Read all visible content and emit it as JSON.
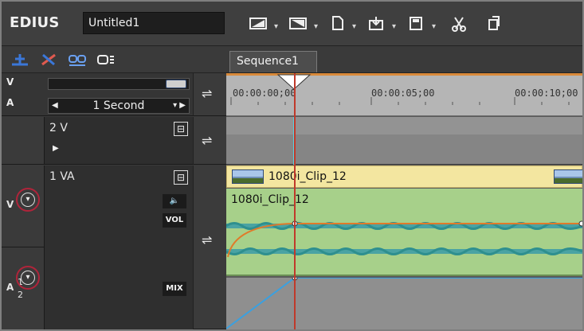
{
  "app": {
    "brand": "EDIUS",
    "project_name": "Untitled1"
  },
  "toolbar": {
    "icons": [
      "layout-icon",
      "layout-alt-icon",
      "new-file-icon",
      "import-icon",
      "save-icon",
      "cut-icon",
      "copy-icon"
    ]
  },
  "subtoolbar": {
    "sequence_tab": "Sequence1"
  },
  "tracks_header": {
    "v_label": "V",
    "a_label": "A",
    "scale_value": "1 Second"
  },
  "tracks": [
    {
      "name": "2 V"
    },
    {
      "name": "1 VA",
      "vol_label": "VOL",
      "mix_label": "MIX",
      "audio_channel_top": "1",
      "audio_channel_bottom": "2"
    }
  ],
  "timeline": {
    "timecodes": [
      "00:00:00;00",
      "00:00:05;00",
      "00:00:10;00"
    ],
    "clip_name_video": "1080i_Clip_12",
    "clip_name_audio": "1080i_Clip_12"
  },
  "colors": {
    "accent_circle": "#b0243a",
    "playhead": "#c0392b",
    "video_clip": "#f3e6a0",
    "audio_clip": "#a7d08a"
  }
}
